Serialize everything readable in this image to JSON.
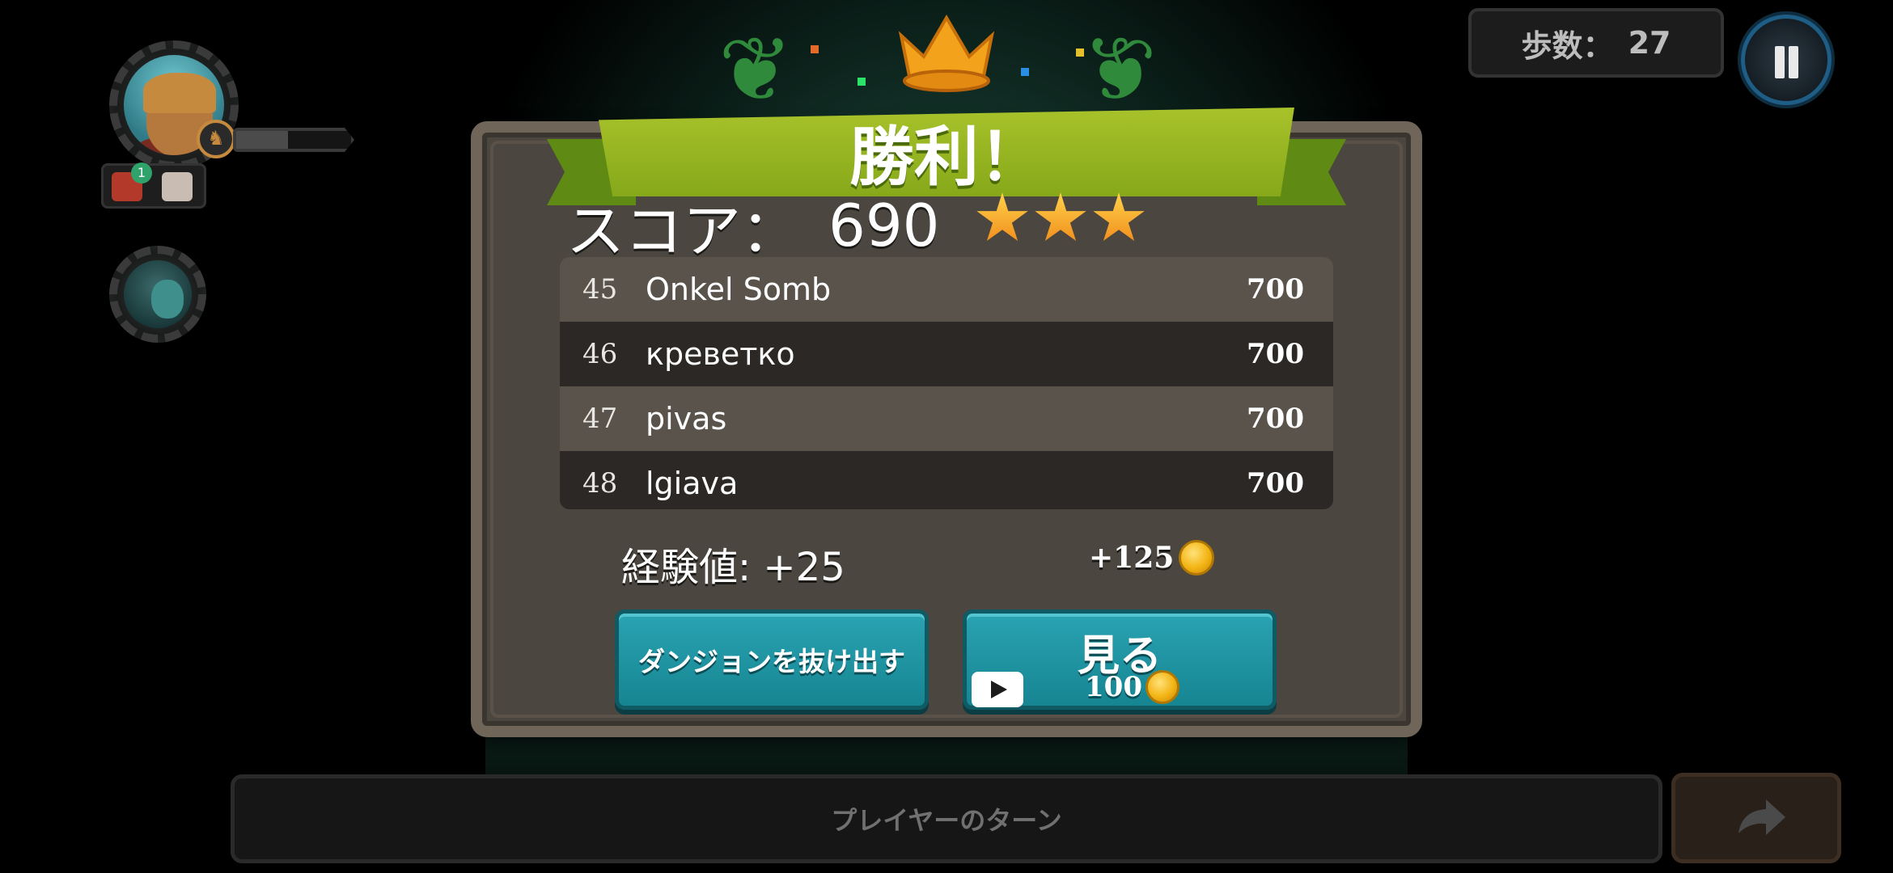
{
  "hud": {
    "steps_label": "歩数：",
    "steps_value": "27",
    "hero_hp_fraction": 0.45,
    "item_count": "1",
    "turn_label": "プレイヤーのターン"
  },
  "dialog": {
    "title": "勝利！",
    "score_label": "スコア：",
    "score_value": "690",
    "stars_earned": 3,
    "leaderboard": [
      {
        "rank": "45",
        "name": "Onkel Somb",
        "score": "700"
      },
      {
        "rank": "46",
        "name": "креветко",
        "score": "700"
      },
      {
        "rank": "47",
        "name": "pivas",
        "score": "700"
      },
      {
        "rank": "48",
        "name": "lgiava",
        "score": "700"
      }
    ],
    "xp_text": "経験値: +25",
    "gold_text": "+125",
    "leave_button": "ダンジョンを抜け出す",
    "watch_button": "見る",
    "watch_cost": "100"
  },
  "colors": {
    "ribbon": "#a8c22a",
    "button": "#2aa3b2",
    "star": "#ffd24a",
    "coin": "#f3b414"
  },
  "icons": {
    "pause": "pause-icon",
    "next": "arrow-right-icon",
    "video": "play-video-icon",
    "coin": "coin-icon",
    "crown": "crown-icon"
  }
}
